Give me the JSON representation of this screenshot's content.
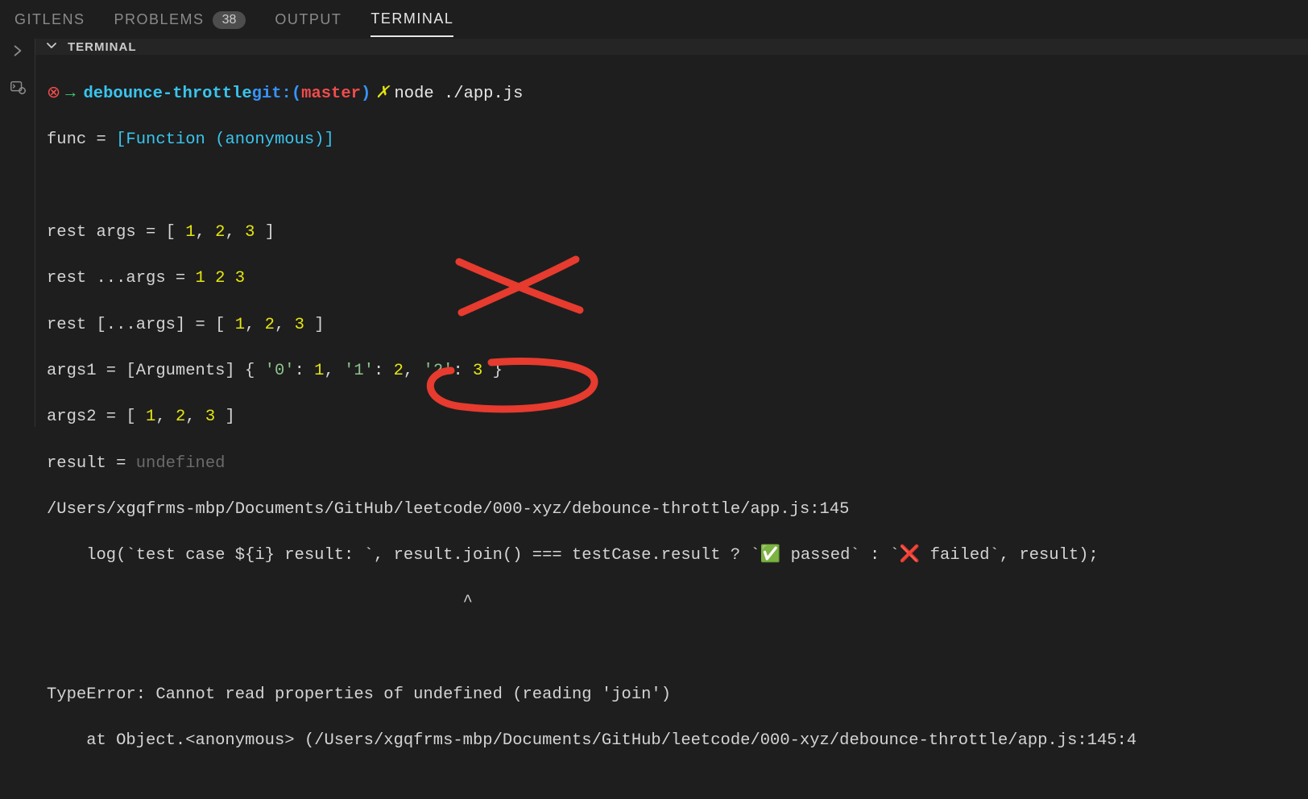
{
  "tabs": {
    "gitlens": "GITLENS",
    "problems": "PROBLEMS",
    "problems_count": "38",
    "output": "OUTPUT",
    "terminal": "TERMINAL"
  },
  "panel": {
    "title": "TERMINAL"
  },
  "prompt": {
    "err_glyph": "⊗",
    "arrow": "→",
    "dir": "debounce-throttle",
    "git_label": "git:(",
    "branch": "master",
    "git_close": ")",
    "dirty": "✗",
    "command": "node ./app.js"
  },
  "out": {
    "l1a": "func = ",
    "l1b": "[Function (anonymous)]",
    "l_blank": "",
    "l3a": "rest args = [ ",
    "l3_1": "1",
    "l3_c": ", ",
    "l3_2": "2",
    "l3_3": "3",
    "l3_close": " ]",
    "l4a": "rest ...args = ",
    "l4_1": "1",
    "l4_s": " ",
    "l4_2": "2",
    "l4_3": "3",
    "l5a": "rest [...args] = [ ",
    "l6a": "args1 = [Arguments] { ",
    "l6_k0": "'0'",
    "l6_colon": ": ",
    "l6_v0": "1",
    "l6_k1": "'1'",
    "l6_v1": "2",
    "l6_k2": "'2'",
    "l6_v2": "3",
    "l6_close": " }",
    "l7a": "args2 = [ ",
    "l8a": "result = ",
    "l8b": "undefined",
    "l9": "/Users/xgqfrms-mbp/Documents/GitHub/leetcode/000-xyz/debounce-throttle/app.js:145",
    "l10": "    log(`test case ${i} result: `, result.join() === testCase.result ? `✅ passed` : `❌ failed`, result);",
    "l11": "                                          ^",
    "l13": "TypeError: Cannot read properties of undefined (reading 'join')",
    "l14": "    at Object.<anonymous> (/Users/xgqfrms-mbp/Documents/GitHub/leetcode/000-xyz/debounce-throttle/app.js:145:4"
  }
}
